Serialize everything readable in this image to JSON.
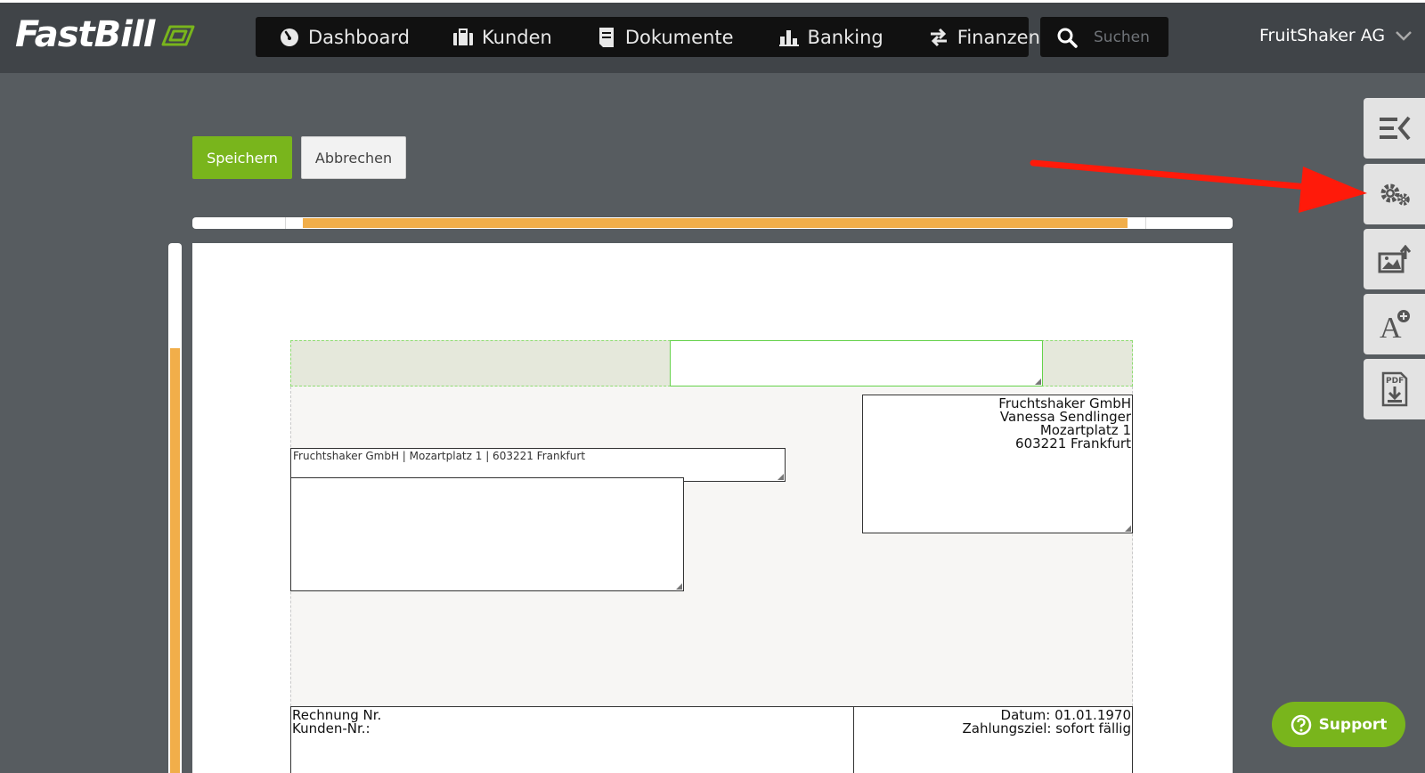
{
  "app": {
    "logo_text": "FastBill",
    "brand_color": "#79b51c",
    "accent_color": "#f1ae4a",
    "annotation_color": "#ff1a0a"
  },
  "nav": {
    "items": [
      {
        "label": "Dashboard",
        "icon": "speedometer-icon"
      },
      {
        "label": "Kunden",
        "icon": "briefcase-icon"
      },
      {
        "label": "Dokumente",
        "icon": "document-icon"
      },
      {
        "label": "Banking",
        "icon": "bar-chart-icon"
      },
      {
        "label": "Finanzen",
        "icon": "transfer-arrows-icon"
      }
    ]
  },
  "search": {
    "placeholder": "Suchen"
  },
  "account": {
    "name": "FruitShaker AG"
  },
  "toolbar": {
    "save_label": "Speichern",
    "cancel_label": "Abbrechen"
  },
  "document": {
    "sender_line": "Fruchtshaker GmbH | Mozartplatz 1 | 603221 Frankfurt",
    "company": {
      "name": "Fruchtshaker GmbH",
      "contact": "Vanessa Sendlinger",
      "street": "Mozartplatz 1",
      "city": "603221 Frankfurt"
    },
    "invoice": {
      "number_label": "Rechnung Nr.",
      "customer_label": "Kunden-Nr.:",
      "date": "Datum: 01.01.1970",
      "payment_terms": "Zahlungsziel: sofort fällig"
    }
  },
  "side_tools": [
    {
      "name": "collapse-panel",
      "icon": "collapse-menu-icon"
    },
    {
      "name": "settings",
      "icon": "gears-icon"
    },
    {
      "name": "image-upload",
      "icon": "image-upload-icon"
    },
    {
      "name": "add-text",
      "icon": "add-font-icon"
    },
    {
      "name": "pdf-download",
      "icon": "pdf-download-icon"
    }
  ],
  "support": {
    "label": "Support"
  }
}
